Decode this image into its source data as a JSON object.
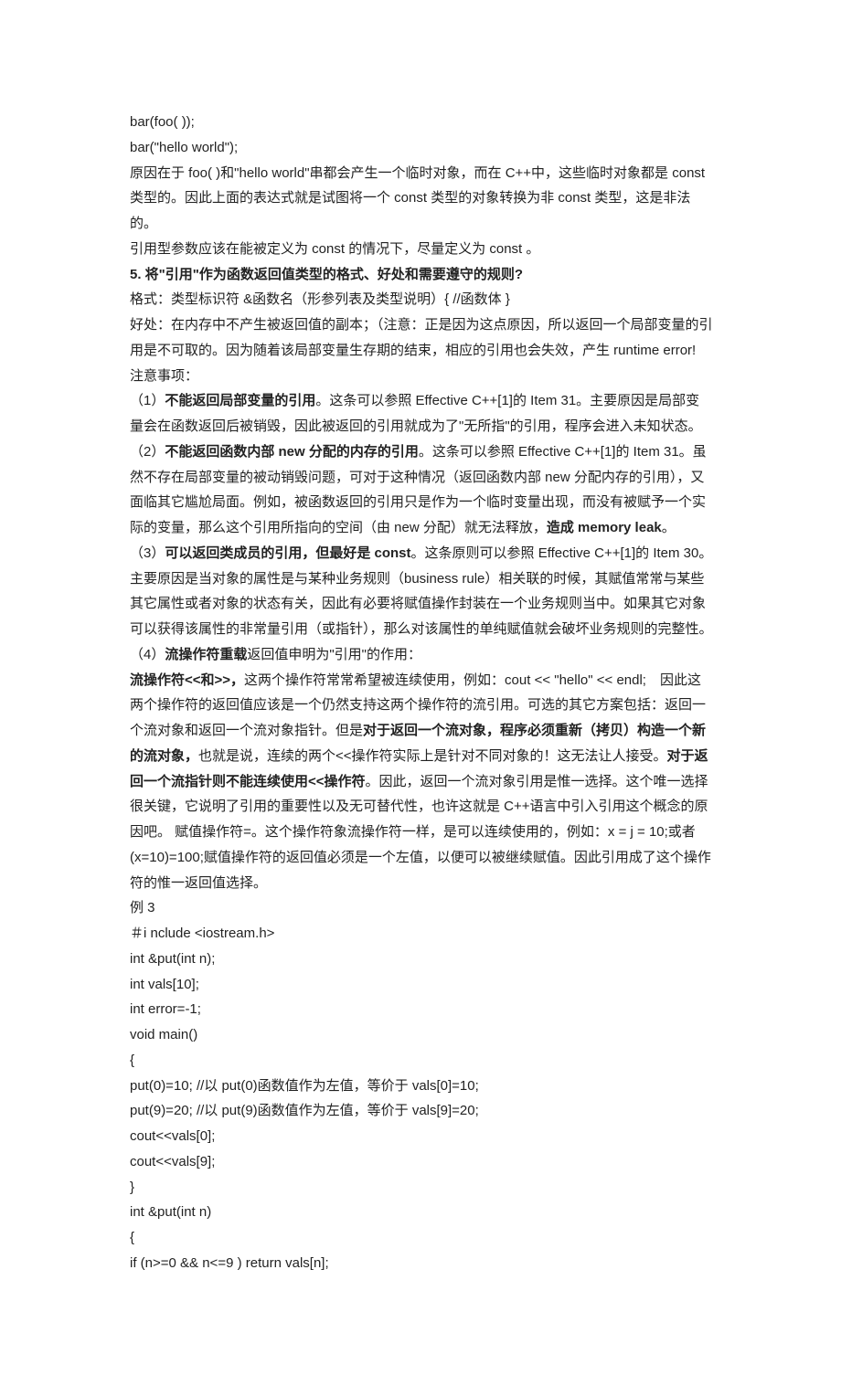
{
  "lines": {
    "l01": "bar(foo( ));",
    "l02": "bar(\"hello world\");",
    "l03": "原因在于 foo( )和\"hello world\"串都会产生一个临时对象，而在 C++中，这些临时对象都是 const 类型的。因此上面的表达式就是试图将一个 const 类型的对象转换为非 const 类型，这是非法的。",
    "l04": "引用型参数应该在能被定义为 const 的情况下，尽量定义为 const 。",
    "l05_bold": "5. 将\"引用\"作为函数返回值类型的格式、好处和需要遵守的规则?",
    "l06": "格式：类型标识符 &函数名（形参列表及类型说明）{ //函数体 }",
    "l07": "好处：在内存中不产生被返回值的副本；（注意：正是因为这点原因，所以返回一个局部变量的引用是不可取的。因为随着该局部变量生存期的结束，相应的引用也会失效，产生 runtime error!",
    "l08": "注意事项：",
    "l09_a": "（1）",
    "l09_b": "不能返回局部变量的引用",
    "l09_c": "。这条可以参照 Effective C++[1]的 Item 31。主要原因是局部变量会在函数返回后被销毁，因此被返回的引用就成为了\"无所指\"的引用，程序会进入未知状态。",
    "l10_a": "（2）",
    "l10_b": "不能返回函数内部 new 分配的内存的引用",
    "l10_c": "。这条可以参照 Effective C++[1]的 Item 31。虽然不存在局部变量的被动销毁问题，可对于这种情况（返回函数内部 new 分配内存的引用），又面临其它尴尬局面。例如，被函数返回的引用只是作为一个临时变量出现，而没有被赋予一个实际的变量，那么这个引用所指向的空间（由 new 分配）就无法释放，",
    "l10_d": "造成 memory leak",
    "l10_e": "。",
    "l11_a": "（3）",
    "l11_b": "可以返回类成员的引用，但最好是 const",
    "l11_c": "。这条原则可以参照 Effective C++[1]的 Item 30。主要原因是当对象的属性是与某种业务规则（business rule）相关联的时候，其赋值常常与某些其它属性或者对象的状态有关，因此有必要将赋值操作封装在一个业务规则当中。如果其它对象可以获得该属性的非常量引用（或指针），那么对该属性的单纯赋值就会破坏业务规则的完整性。",
    "l12_a": "（4）",
    "l12_b": "流操作符重载",
    "l12_c": "返回值申明为\"引用\"的作用：",
    "l13_a": "流操作符<<和>>，",
    "l13_b": "这两个操作符常常希望被连续使用，例如：cout << \"hello\" << endl;　因此这两个操作符的返回值应该是一个仍然支持这两个操作符的流引用。可选的其它方案包括：返回一个流对象和返回一个流对象指针。但是",
    "l13_c": "对于返回一个流对象，程序必须重新（拷贝）构造一个新的流对象，",
    "l13_d": "也就是说，连续的两个<<操作符实际上是针对不同对象的！这无法让人接受。",
    "l13_e": "对于返回一个流指针则不能连续使用<<操作符",
    "l13_f": "。因此，返回一个流对象引用是惟一选择。这个唯一选择很关键，它说明了引用的重要性以及无可替代性，也许这就是 C++语言中引入引用这个概念的原因吧。 赋值操作符=。这个操作符象流操作符一样，是可以连续使用的，例如：x = j = 10;或者(x=10)=100;赋值操作符的返回值必须是一个左值，以便可以被继续赋值。因此引用成了这个操作符的惟一返回值选择。",
    "l14": "例 3",
    "l15": "＃i nclude <iostream.h>",
    "l16": "int &put(int n);",
    "l17": "int vals[10];",
    "l18": "int error=-1;",
    "l19": "void main()",
    "l20": "{",
    "l21": "put(0)=10; //以 put(0)函数值作为左值，等价于 vals[0]=10;",
    "l22": "put(9)=20; //以 put(9)函数值作为左值，等价于 vals[9]=20;",
    "l23": "cout<<vals[0];",
    "l24": "cout<<vals[9];",
    "l25": "}",
    "l26": "int &put(int n)",
    "l27": "{",
    "l28": "if (n>=0 && n<=9 ) return vals[n];"
  }
}
